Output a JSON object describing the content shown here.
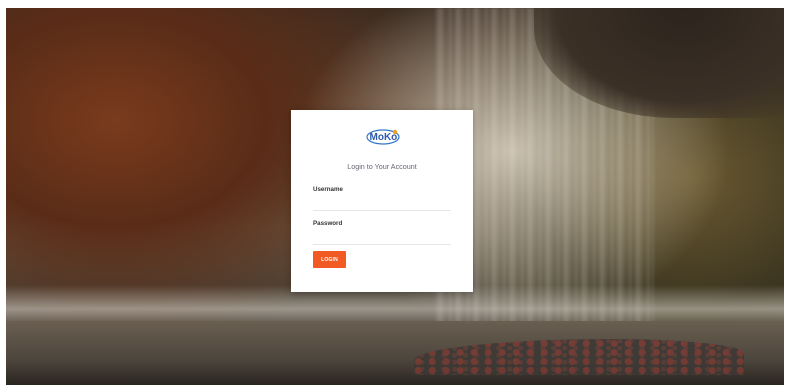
{
  "brand": {
    "logo_text": "MoKo",
    "logo_colors": [
      "#2e5aa8",
      "#2f76c8",
      "#f0a11d"
    ]
  },
  "login": {
    "title": "Login to Your Account",
    "username_label": "Username",
    "password_label": "Password",
    "username_value": "",
    "password_value": "",
    "button_label": "LOGIN",
    "button_color": "#f15a22"
  },
  "background": {
    "scene": "forest-waterfall-photo"
  }
}
